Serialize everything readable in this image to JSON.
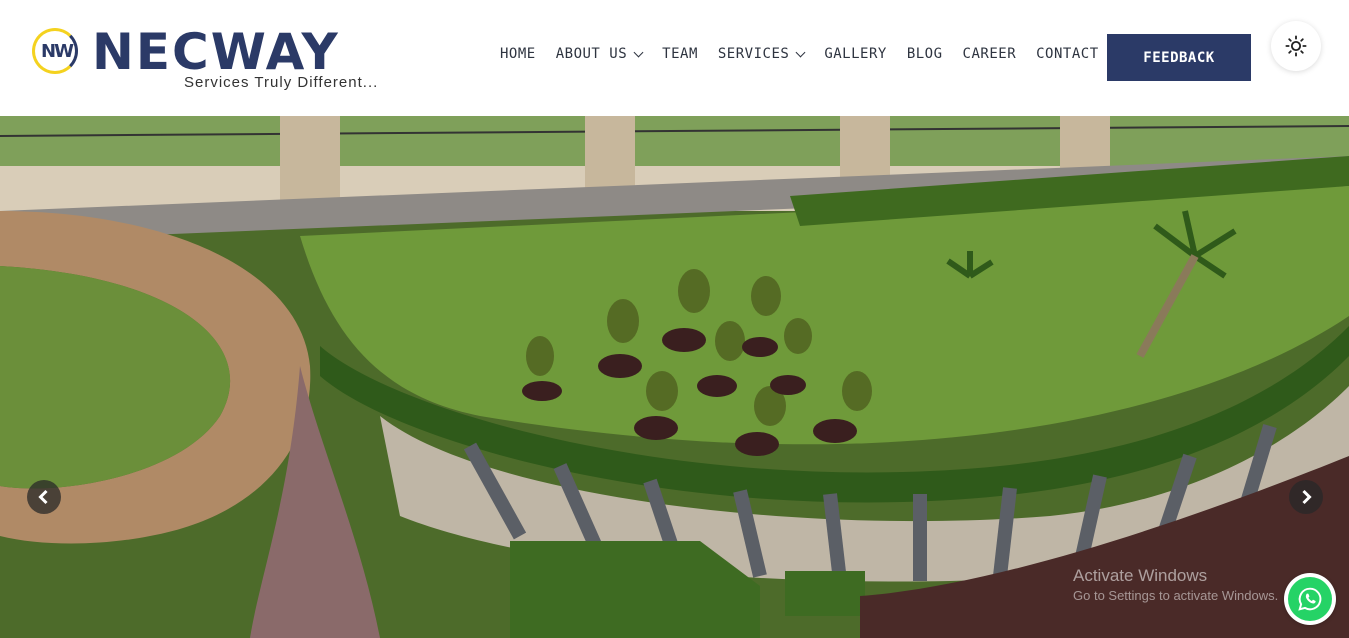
{
  "brand": {
    "name": "NECWAY",
    "mark": "NW",
    "tagline": "Services Truly Different..."
  },
  "nav": {
    "items": [
      {
        "label": "HOME",
        "has_dropdown": false
      },
      {
        "label": "ABOUT US",
        "has_dropdown": true
      },
      {
        "label": "TEAM",
        "has_dropdown": false
      },
      {
        "label": "SERVICES",
        "has_dropdown": true
      },
      {
        "label": "GALLERY",
        "has_dropdown": false
      },
      {
        "label": "BLOG",
        "has_dropdown": false
      },
      {
        "label": "CAREER",
        "has_dropdown": false
      },
      {
        "label": "CONTACT US",
        "has_dropdown": false
      }
    ],
    "feedback_label": "FEEDBACK"
  },
  "theme_toggle": {
    "icon": "sun-icon"
  },
  "slider": {
    "prev_icon": "chevron-left-icon",
    "next_icon": "chevron-right-icon"
  },
  "os_watermark": {
    "title": "Activate Windows",
    "subtitle": "Go to Settings to activate Windows."
  },
  "whatsapp": {
    "icon": "whatsapp-icon"
  },
  "colors": {
    "brand_navy": "#2b3a67",
    "brand_yellow": "#f4d21f",
    "whatsapp_green": "#25d366"
  }
}
